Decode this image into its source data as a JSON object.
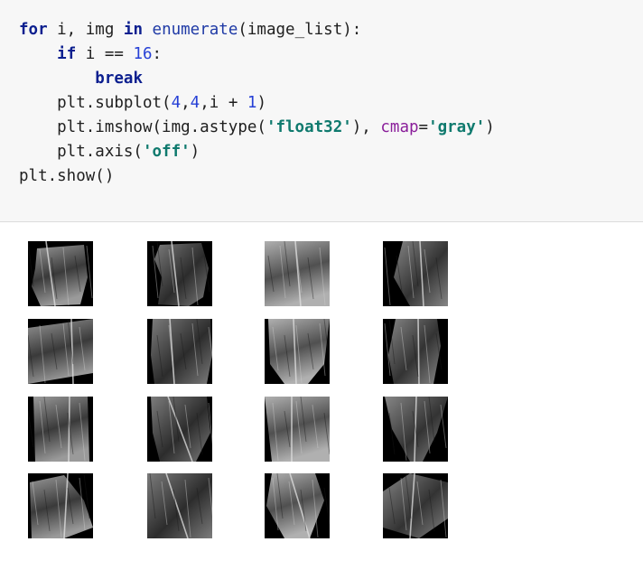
{
  "code_cell": {
    "lines": [
      [
        {
          "t": "kw",
          "v": "for"
        },
        {
          "t": "plain",
          "v": " i, img "
        },
        {
          "t": "kw",
          "v": "in"
        },
        {
          "t": "plain",
          "v": " "
        },
        {
          "t": "fn",
          "v": "enumerate"
        },
        {
          "t": "plain",
          "v": "(image_list):"
        }
      ],
      [
        {
          "t": "plain",
          "v": "    "
        },
        {
          "t": "kw",
          "v": "if"
        },
        {
          "t": "plain",
          "v": " i == "
        },
        {
          "t": "num",
          "v": "16"
        },
        {
          "t": "plain",
          "v": ":"
        }
      ],
      [
        {
          "t": "plain",
          "v": "        "
        },
        {
          "t": "kw",
          "v": "break"
        }
      ],
      [
        {
          "t": "plain",
          "v": "    plt.subplot("
        },
        {
          "t": "num",
          "v": "4"
        },
        {
          "t": "plain",
          "v": ","
        },
        {
          "t": "num",
          "v": "4"
        },
        {
          "t": "plain",
          "v": ",i + "
        },
        {
          "t": "num",
          "v": "1"
        },
        {
          "t": "plain",
          "v": ")"
        }
      ],
      [
        {
          "t": "plain",
          "v": "    plt.imshow(img.astype("
        },
        {
          "t": "str",
          "v": "'float32'"
        },
        {
          "t": "plain",
          "v": "), "
        },
        {
          "t": "param",
          "v": "cmap"
        },
        {
          "t": "plain",
          "v": "="
        },
        {
          "t": "str",
          "v": "'gray'"
        },
        {
          "t": "plain",
          "v": ")"
        }
      ],
      [
        {
          "t": "plain",
          "v": "    plt.axis("
        },
        {
          "t": "str",
          "v": "'off'"
        },
        {
          "t": "plain",
          "v": ")"
        }
      ],
      [
        {
          "t": "plain",
          "v": "plt.show()"
        }
      ]
    ]
  },
  "output": {
    "grid_rows": 4,
    "grid_cols": 4,
    "images": [
      {
        "name": "leaf-image-1"
      },
      {
        "name": "leaf-image-2"
      },
      {
        "name": "leaf-image-3"
      },
      {
        "name": "leaf-image-4"
      },
      {
        "name": "leaf-image-5"
      },
      {
        "name": "leaf-image-6"
      },
      {
        "name": "leaf-image-7"
      },
      {
        "name": "leaf-image-8"
      },
      {
        "name": "leaf-image-9"
      },
      {
        "name": "leaf-image-10"
      },
      {
        "name": "leaf-image-11"
      },
      {
        "name": "leaf-image-12"
      },
      {
        "name": "leaf-image-13"
      },
      {
        "name": "leaf-image-14"
      },
      {
        "name": "leaf-image-15"
      },
      {
        "name": "leaf-image-16"
      }
    ]
  },
  "colors": {
    "keyword": "#0c1f8f",
    "function": "#1f3aa6",
    "number": "#2640d6",
    "string": "#0f7a6e",
    "parameter": "#8a1e9a",
    "cell_background": "#f7f7f7"
  }
}
